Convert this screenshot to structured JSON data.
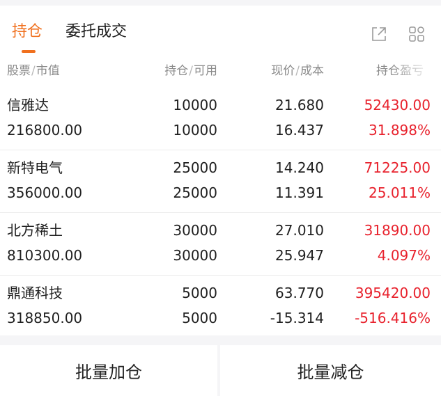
{
  "tabs": [
    {
      "label": "持仓"
    },
    {
      "label": "委托成交"
    }
  ],
  "toolbar": {
    "icons": [
      "share-icon",
      "grid-icon"
    ]
  },
  "columns": {
    "name": "股票",
    "market_value": "市值",
    "position": "持仓",
    "available": "可用",
    "price": "现价",
    "cost": "成本",
    "pnl": "持仓盈亏"
  },
  "holdings": [
    {
      "name": "信雅达",
      "market_value": "216800.00",
      "position": "10000",
      "available": "10000",
      "price": "21.680",
      "cost": "16.437",
      "pnl": "52430.00",
      "pnl_pct": "31.898%"
    },
    {
      "name": "新特电气",
      "market_value": "356000.00",
      "position": "25000",
      "available": "25000",
      "price": "14.240",
      "cost": "11.391",
      "pnl": "71225.00",
      "pnl_pct": "25.011%"
    },
    {
      "name": "北方稀土",
      "market_value": "810300.00",
      "position": "30000",
      "available": "30000",
      "price": "27.010",
      "cost": "25.947",
      "pnl": "31890.00",
      "pnl_pct": "4.097%"
    },
    {
      "name": "鼎通科技",
      "market_value": "318850.00",
      "position": "5000",
      "available": "5000",
      "price": "63.770",
      "cost": "-15.314",
      "pnl": "395420.00",
      "pnl_pct": "-516.416%"
    }
  ],
  "footer": {
    "batch_add": "批量加仓",
    "batch_reduce": "批量减仓"
  },
  "colors": {
    "accent": "#f0701e",
    "profit_red": "#e8222d"
  }
}
